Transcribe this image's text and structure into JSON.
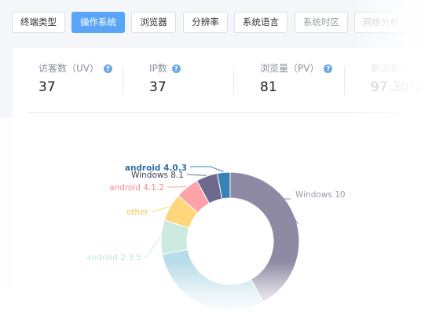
{
  "tabs": [
    {
      "label": "终端类型",
      "state": "normal"
    },
    {
      "label": "操作系统",
      "state": "active"
    },
    {
      "label": "浏览器",
      "state": "normal"
    },
    {
      "label": "分辨率",
      "state": "normal"
    },
    {
      "label": "系统语言",
      "state": "normal"
    },
    {
      "label": "系统时区",
      "state": "dim"
    },
    {
      "label": "网络分析",
      "state": "faint"
    }
  ],
  "stats": [
    {
      "label": "访客数（UV）",
      "value": "37"
    },
    {
      "label": "IP数",
      "value": "37"
    },
    {
      "label": "浏览量（PV）",
      "value": "81"
    },
    {
      "label": "新访客占",
      "value": "97.30%"
    }
  ],
  "help_glyph": "?",
  "chart_data": {
    "type": "pie",
    "donut": true,
    "series": [
      {
        "name": "Windows 10",
        "value": 42,
        "color": "#8e8aa3"
      },
      {
        "name": "",
        "value": 30,
        "color": "#b8dce9"
      },
      {
        "name": "android 2.3.5",
        "value": 8,
        "color": "#cdeae0"
      },
      {
        "name": "other",
        "value": 6.5,
        "color": "#fdd77a"
      },
      {
        "name": "android 4.1.2",
        "value": 5.5,
        "color": "#fba3a8"
      },
      {
        "name": "Windows 8.1",
        "value": 5,
        "color": "#6d6a8e"
      },
      {
        "name": "android 4.0.3",
        "value": 3,
        "color": "#3783b8"
      }
    ]
  }
}
